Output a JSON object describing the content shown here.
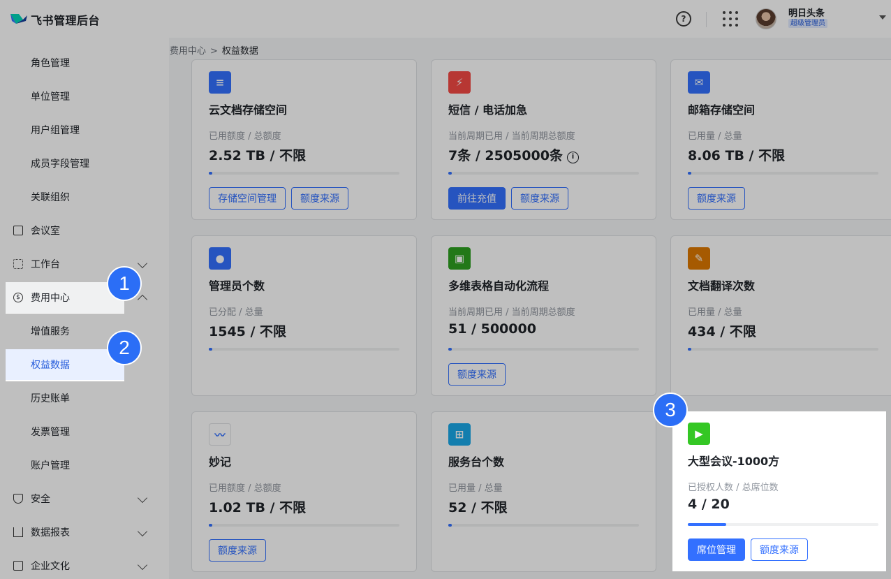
{
  "header": {
    "app_title": "飞书管理后台",
    "help_glyph": "?",
    "user_name": "明日头条",
    "user_role": "超级管理员"
  },
  "sidebar": {
    "items": [
      {
        "label": "角色管理",
        "level": "sub"
      },
      {
        "label": "单位管理",
        "level": "sub"
      },
      {
        "label": "用户组管理",
        "level": "sub"
      },
      {
        "label": "成员字段管理",
        "level": "sub"
      },
      {
        "label": "关联组织",
        "level": "sub"
      },
      {
        "label": "会议室",
        "level": "top",
        "icon": "meeting-room-icon"
      },
      {
        "label": "工作台",
        "level": "top",
        "icon": "workbench-grid-icon",
        "chevron": "down"
      },
      {
        "label": "费用中心",
        "level": "top",
        "icon": "dollar-icon",
        "chevron": "up",
        "highlighted": true
      },
      {
        "label": "增值服务",
        "level": "sub"
      },
      {
        "label": "权益数据",
        "level": "sub",
        "active": true,
        "highlighted": true
      },
      {
        "label": "历史账单",
        "level": "sub"
      },
      {
        "label": "发票管理",
        "level": "sub"
      },
      {
        "label": "账户管理",
        "level": "sub"
      },
      {
        "label": "安全",
        "level": "top",
        "icon": "shield-icon",
        "chevron": "down"
      },
      {
        "label": "数据报表",
        "level": "top",
        "icon": "bar-chart-icon",
        "chevron": "down"
      },
      {
        "label": "企业文化",
        "level": "top",
        "icon": "culture-icon",
        "chevron": "down"
      }
    ]
  },
  "breadcrumb": {
    "parent": "费用中心",
    "separator": ">",
    "current": "权益数据"
  },
  "cards": [
    {
      "title": "云文档存储空间",
      "label": "已用额度 / 总额度",
      "value": "2.52 TB / 不限",
      "progress": 0.02,
      "icon": "cloud-doc-icon",
      "icon_color": "#3370ff",
      "buttons": [
        {
          "label": "存储空间管理",
          "primary": false
        },
        {
          "label": "额度来源",
          "primary": false
        }
      ]
    },
    {
      "title": "短信 / 电话加急",
      "label": "当前周期已用 / 当前周期总额度",
      "value": "7条 / 2505000条",
      "info_glyph": "i",
      "progress": 0.02,
      "icon": "lightning-icon",
      "icon_color": "#f54a45",
      "buttons": [
        {
          "label": "前往充值",
          "primary": true
        },
        {
          "label": "额度来源",
          "primary": false
        }
      ]
    },
    {
      "title": "邮箱存储空间",
      "label": "已用量 / 总量",
      "value": "8.06 TB / 不限",
      "progress": 0.02,
      "icon": "mail-icon",
      "icon_color": "#3370ff",
      "buttons": [
        {
          "label": "额度来源",
          "primary": false
        }
      ]
    },
    {
      "title": "管理员个数",
      "label": "已分配 / 总量",
      "value": "1545 / 不限",
      "progress": 0.02,
      "icon": "admin-user-icon",
      "icon_color": "#3370ff",
      "buttons": []
    },
    {
      "title": "多维表格自动化流程",
      "label": "当前周期已用 / 当前周期总额度",
      "value": "51 / 500000",
      "progress": 0.02,
      "icon": "robot-icon",
      "icon_color": "#2ea121",
      "buttons": [
        {
          "label": "额度来源",
          "primary": false
        }
      ]
    },
    {
      "title": "文档翻译次数",
      "label": "已用量 / 总量",
      "value": "434 / 不限",
      "progress": 0.02,
      "icon": "doc-translate-icon",
      "icon_color": "#de7802",
      "buttons": []
    },
    {
      "title": "妙记",
      "label": "已用额度 / 总额度",
      "value": "1.02 TB / 不限",
      "progress": 0.02,
      "icon": "minutes-icon",
      "icon_color": "#ffffff",
      "buttons": [
        {
          "label": "额度来源",
          "primary": false
        }
      ]
    },
    {
      "title": "服务台个数",
      "label": "已用量 / 总量",
      "value": "52 / 不限",
      "progress": 0.02,
      "icon": "helpdesk-icon",
      "icon_color": "#1aa8e8",
      "buttons": []
    },
    {
      "title": "大型会议-1000方",
      "label": "已授权人数 / 总席位数",
      "value": "4 / 20",
      "progress": 0.2,
      "icon": "video-meeting-icon",
      "icon_color": "#34c724",
      "highlighted": true,
      "buttons": [
        {
          "label": "席位管理",
          "primary": true
        },
        {
          "label": "额度来源",
          "primary": false
        }
      ]
    }
  ],
  "steps": [
    "1",
    "2",
    "3"
  ],
  "colors": {
    "accent": "#3370ff",
    "step_badge": "#2b6ef6"
  }
}
